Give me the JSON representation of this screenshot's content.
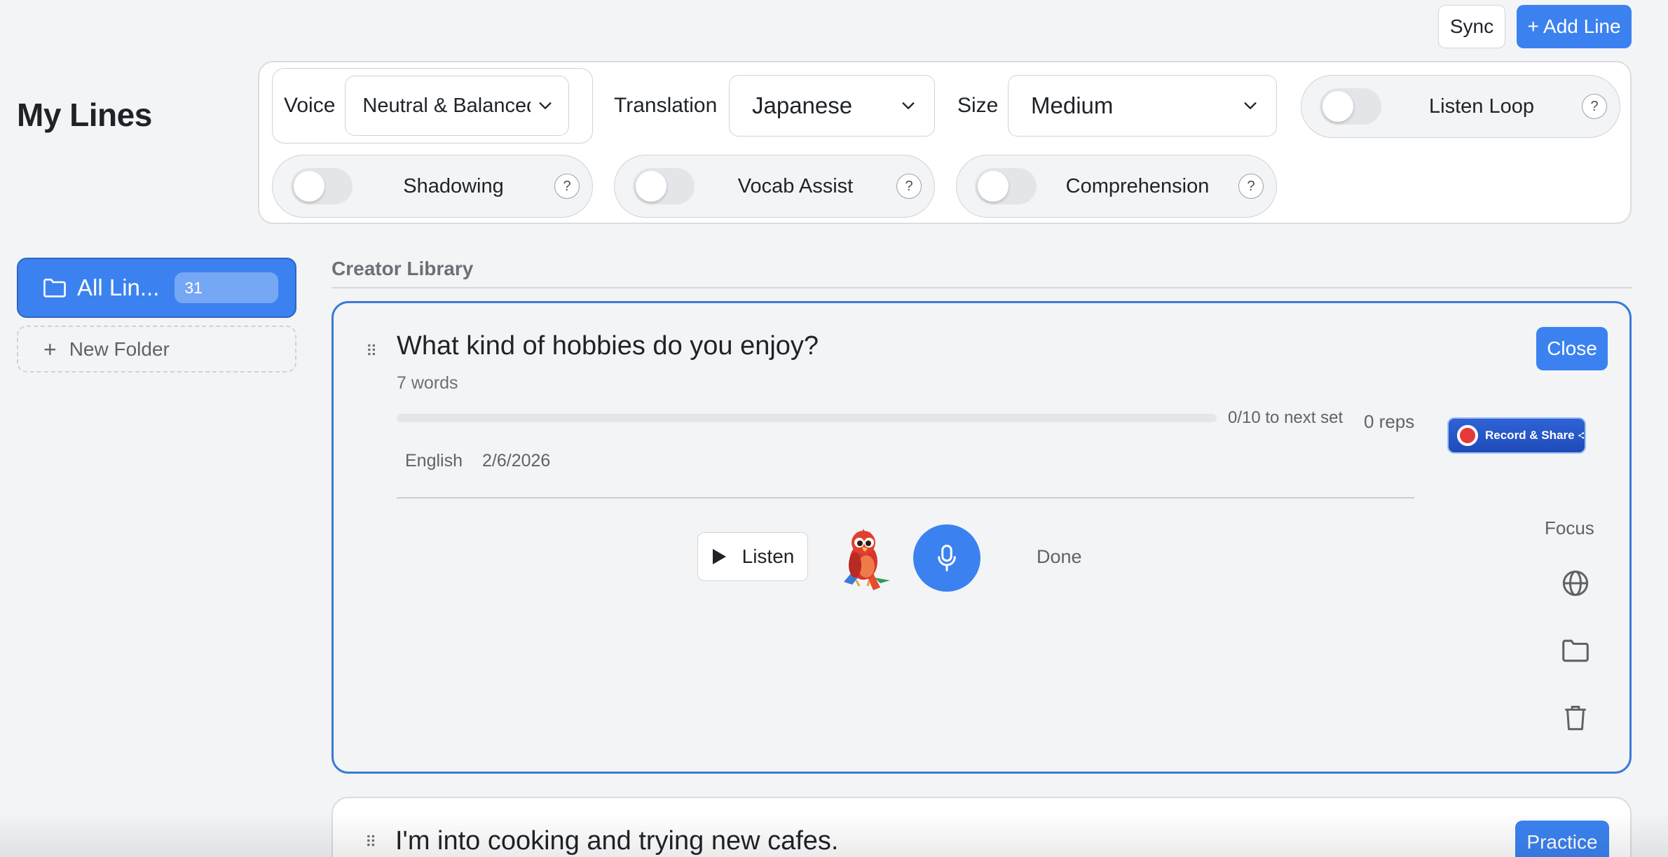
{
  "topbar": {
    "sync_label": "Sync",
    "add_line_label": "+ Add Line"
  },
  "page_title": "My Lines",
  "settings": {
    "voice_label": "Voice",
    "voice_value": "Neutral & Balanced",
    "translation_label": "Translation",
    "translation_value": "Japanese",
    "size_label": "Size",
    "size_value": "Medium",
    "toggles": {
      "listen_loop": "Listen Loop",
      "shadowing": "Shadowing",
      "vocab_assist": "Vocab Assist",
      "comprehension": "Comprehension"
    },
    "help_glyph": "?"
  },
  "sidebar": {
    "all_lines_label": "All Lin...",
    "all_lines_count": "31",
    "new_folder_label": "New Folder"
  },
  "library": {
    "heading": "Creator Library",
    "active_card": {
      "title": "What kind of hobbies do you enjoy?",
      "word_count": "7 words",
      "progress_text": "0/10 to next set",
      "progress_fraction": 0,
      "reps": "0 reps",
      "language": "English",
      "date": "2/6/2026",
      "close_label": "Close",
      "record_share_label": "Record & Share",
      "listen_label": "Listen",
      "done_label": "Done",
      "focus_label": "Focus"
    },
    "next_card": {
      "title": "I'm into cooking and trying new cafes.",
      "practice_label": "Practice"
    }
  },
  "colors": {
    "accent": "#3b82f0",
    "background": "#f3f4f6",
    "record_red": "#e5393a"
  }
}
